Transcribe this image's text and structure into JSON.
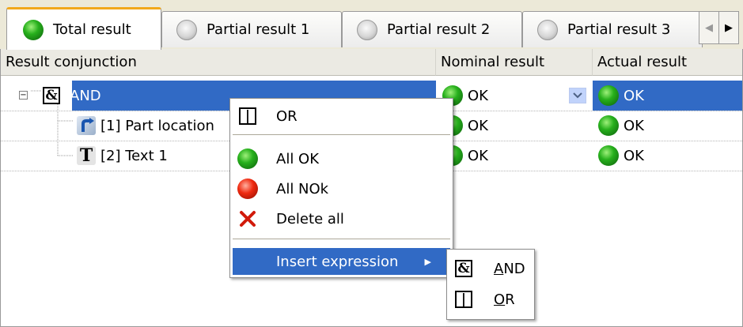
{
  "tabs": [
    {
      "label": "Total result",
      "status": "green"
    },
    {
      "label": "Partial result 1",
      "status": "grey"
    },
    {
      "label": "Partial result 2",
      "status": "grey"
    },
    {
      "label": "Partial result 3",
      "status": "grey"
    }
  ],
  "columns": {
    "conjunction": "Result conjunction",
    "nominal": "Nominal result",
    "actual": "Actual result"
  },
  "rows": [
    {
      "icon": "and-icon",
      "glyph": "&",
      "label": "AND",
      "nominal": "OK",
      "actual": "OK",
      "selected": true
    },
    {
      "icon": "part-location-icon",
      "label": "[1] Part location",
      "nominal": "OK",
      "actual": "OK"
    },
    {
      "icon": "text-icon",
      "glyph": "T",
      "label": "[2] Text 1",
      "nominal": "OK",
      "actual": "OK"
    }
  ],
  "context_menu": {
    "or_label": "OR",
    "or_glyph": "|",
    "all_ok": "All OK",
    "all_nok": "All NOk",
    "delete_all": "Delete all",
    "insert_expression": "Insert expression"
  },
  "submenu": {
    "and_glyph": "&",
    "and_first": "A",
    "and_rest": "ND",
    "or_glyph": "|",
    "or_first": "O",
    "or_rest": "R"
  },
  "colors": {
    "selection": "#316ac5",
    "active_tab_accent": "#f2a81b",
    "ok_green": "#27b01c",
    "nok_red": "#ef2a10"
  }
}
